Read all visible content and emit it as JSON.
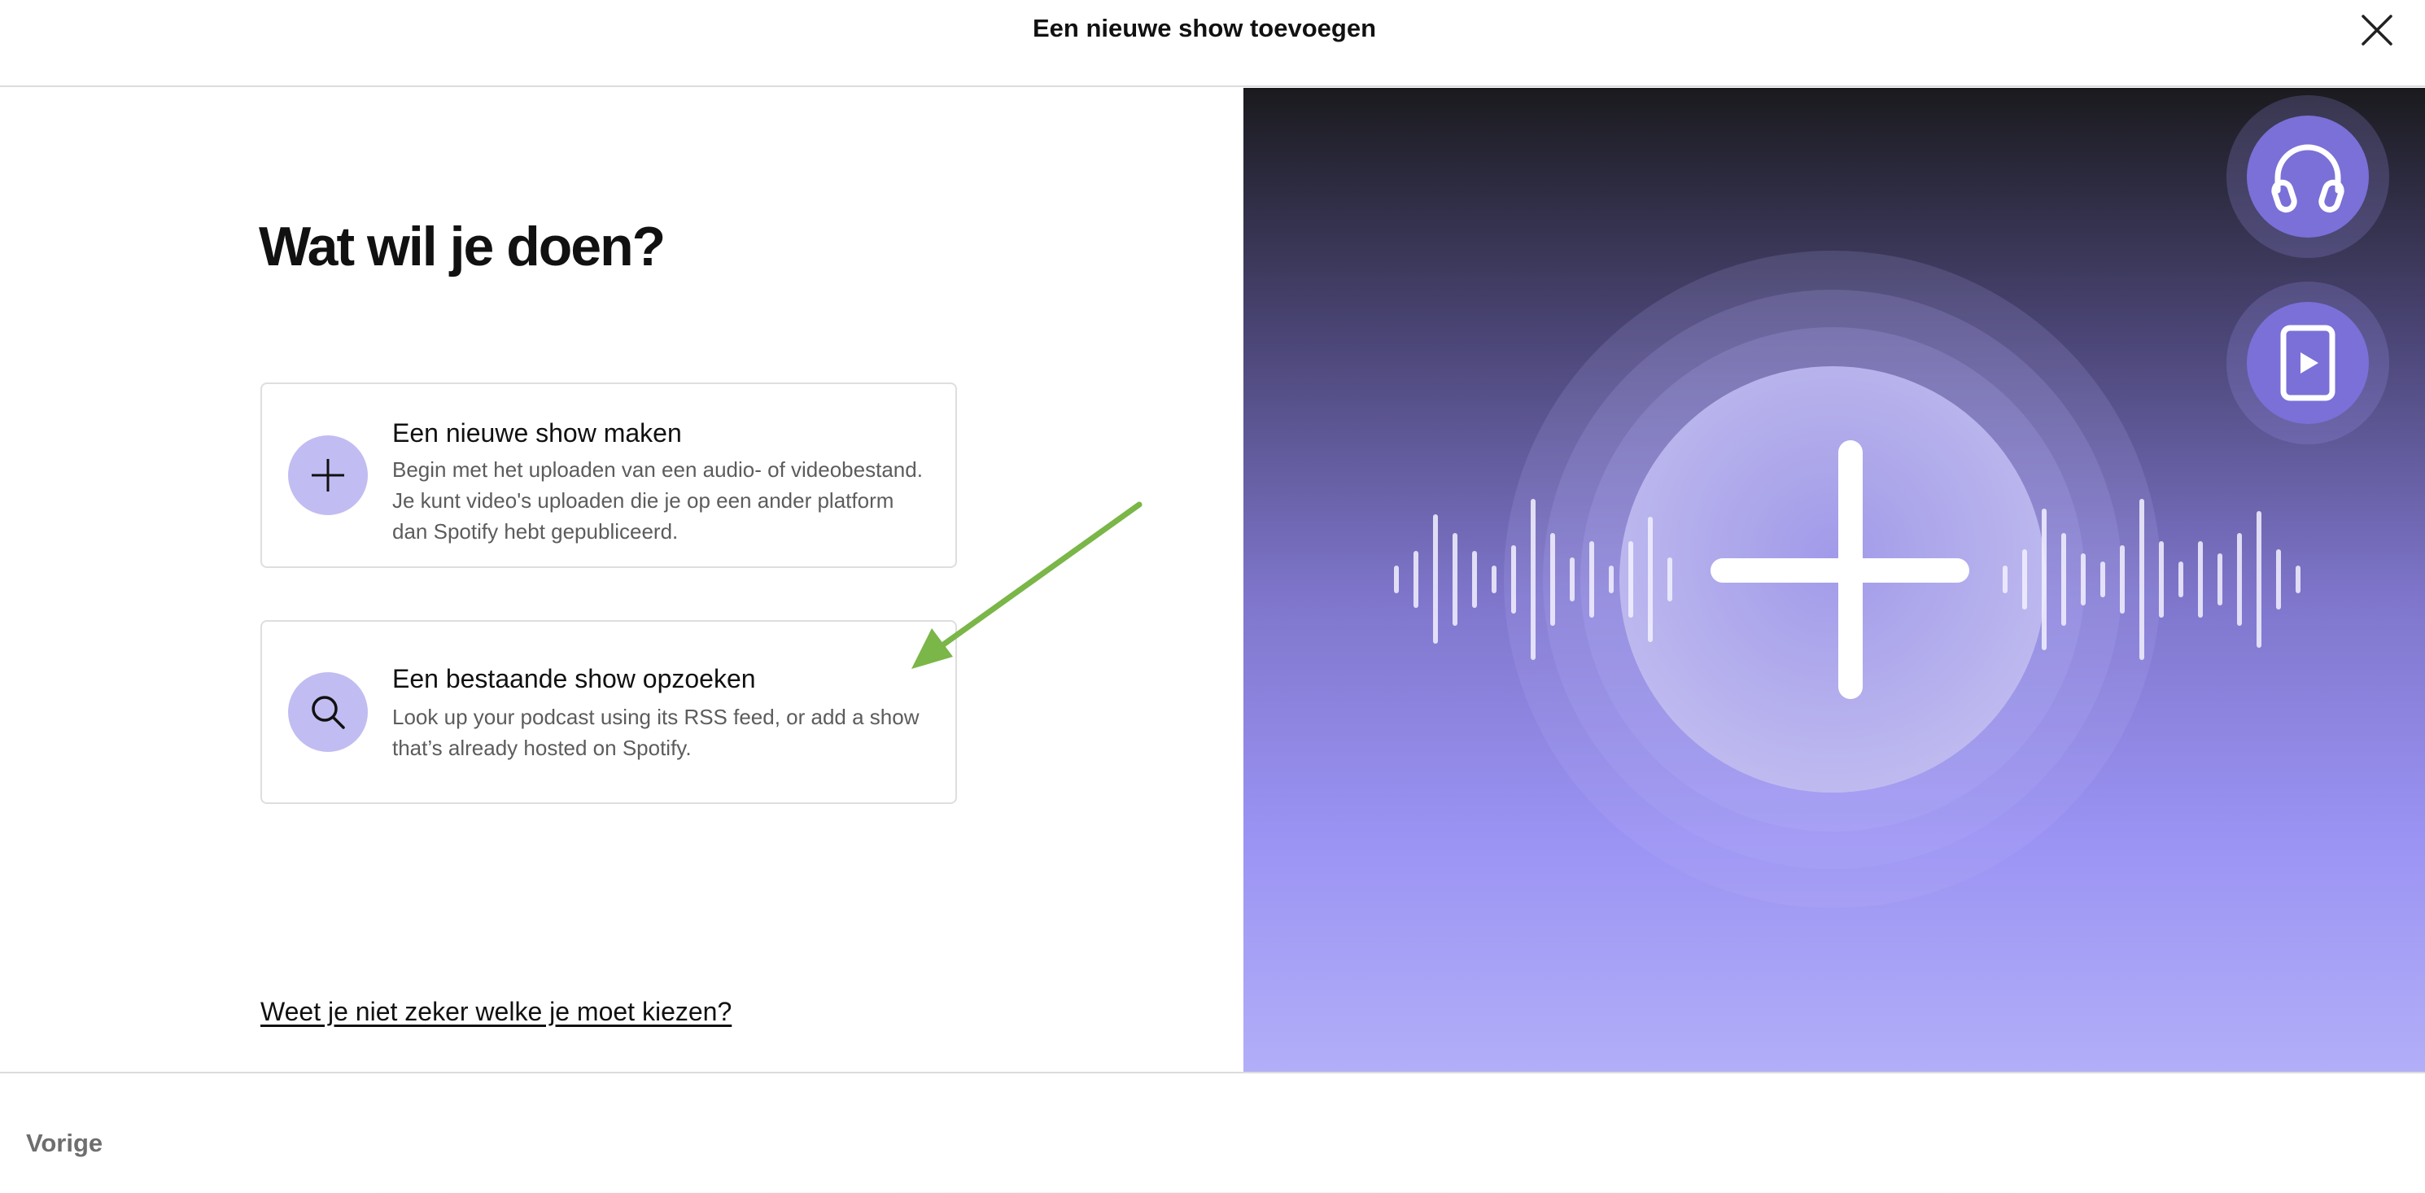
{
  "header": {
    "title": "Een nieuwe show toevoegen",
    "close_icon": "close-icon"
  },
  "main": {
    "heading": "Wat wil je doen?",
    "options": [
      {
        "icon": "plus-icon",
        "title": "Een nieuwe show maken",
        "description": "Begin met het uploaden van een audio- of videobestand. Je kunt video's uploaden die je op een ander platform dan Spotify hebt gepubliceerd."
      },
      {
        "icon": "search-icon",
        "title": "Een bestaande show opzoeken",
        "description": "Look up your podcast using its RSS feed, or add a show that’s already hosted on Spotify."
      }
    ],
    "help_link": "Weet je niet zeker welke je moet kiezen?"
  },
  "illustration": {
    "center_icon": "plus-icon",
    "side_buttons": [
      {
        "icon": "headphones-icon"
      },
      {
        "icon": "video-play-icon"
      }
    ]
  },
  "footer": {
    "back_label": "Vorige"
  },
  "colors": {
    "accent": "#c1bdf2",
    "annotation_arrow": "#7ab648",
    "art_top": "#1a1a1e",
    "art_bottom": "#b2aef8"
  }
}
